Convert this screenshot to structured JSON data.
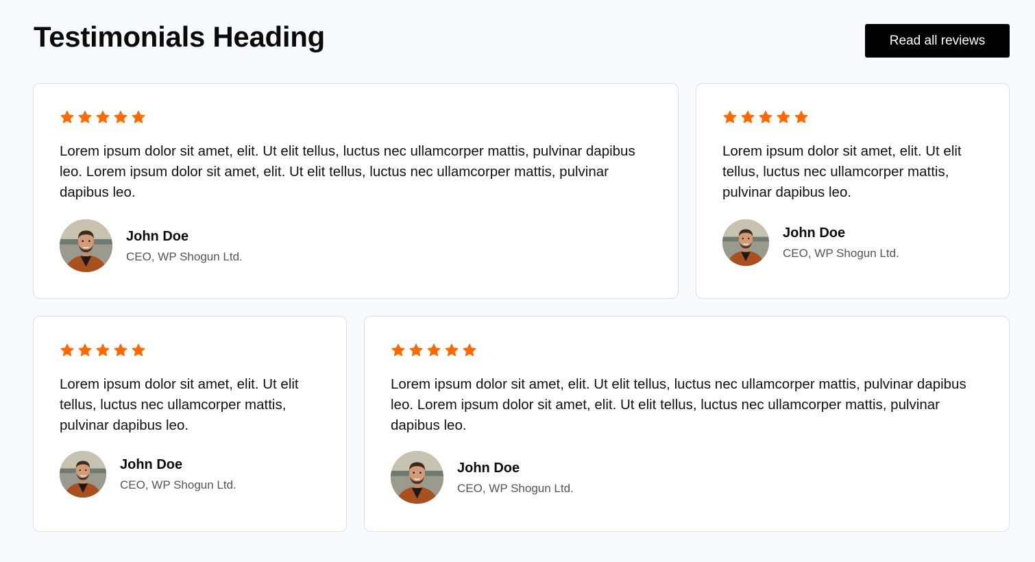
{
  "header": {
    "title": "Testimonials Heading",
    "cta_label": "Read all reviews"
  },
  "colors": {
    "star": "#ff6a00",
    "button_bg": "#000000",
    "page_bg": "#f8fbfe"
  },
  "testimonials": [
    {
      "rating": 5,
      "quote": "Lorem ipsum dolor sit amet, elit. Ut elit tellus, luctus nec ullamcorper mattis, pulvinar dapibus leo. Lorem ipsum dolor sit amet, elit. Ut elit tellus, luctus nec ullamcorper mattis, pulvinar dapibus leo.",
      "name": "John Doe",
      "role": "CEO, WP Shogun Ltd."
    },
    {
      "rating": 5,
      "quote": "Lorem ipsum dolor sit amet, elit. Ut elit tellus, luctus nec ullamcorper mattis, pulvinar dapibus leo.",
      "name": "John Doe",
      "role": "CEO, WP Shogun Ltd."
    },
    {
      "rating": 5,
      "quote": "Lorem ipsum dolor sit amet, elit. Ut elit tellus, luctus nec ullamcorper mattis, pulvinar dapibus leo.",
      "name": "John Doe",
      "role": "CEO, WP Shogun Ltd."
    },
    {
      "rating": 5,
      "quote": "Lorem ipsum dolor sit amet, elit. Ut elit tellus, luctus nec ullamcorper mattis, pulvinar dapibus leo. Lorem ipsum dolor sit amet, elit. Ut elit tellus, luctus nec ullamcorper mattis, pulvinar dapibus leo.",
      "name": "John Doe",
      "role": "CEO, WP Shogun Ltd."
    }
  ]
}
